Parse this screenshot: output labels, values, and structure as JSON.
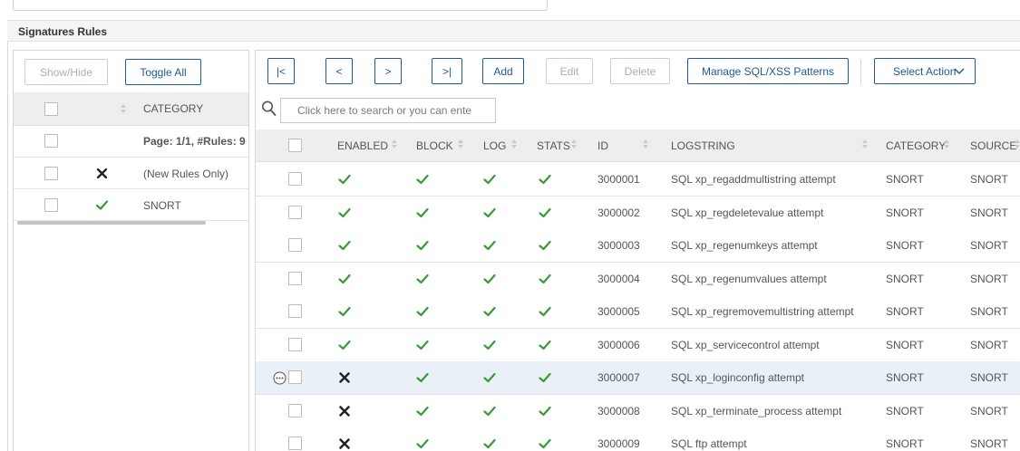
{
  "section": {
    "title": "Signatures Rules"
  },
  "left": {
    "show_hide": "Show/Hide",
    "toggle_all": "Toggle All",
    "header": {
      "category": "CATEGORY"
    },
    "rows": [
      {
        "label": "Page: 1/1, #Rules: 9",
        "status": "none"
      },
      {
        "label": "(New Rules Only)",
        "status": "cross"
      },
      {
        "label": "SNORT",
        "status": "check"
      }
    ]
  },
  "toolbar": {
    "first": "|<",
    "prev": "<",
    "next": ">",
    "last": ">|",
    "add": "Add",
    "edit": "Edit",
    "delete": "Delete",
    "manage": "Manage SQL/XSS Patterns",
    "select_action": "Select Action"
  },
  "search": {
    "placeholder": "Click here to search or you can ente"
  },
  "table": {
    "headers": {
      "enabled": "ENABLED",
      "block": "BLOCK",
      "log": "LOG",
      "stats": "STATS",
      "id": "ID",
      "logstring": "LOGSTRING",
      "category": "CATEGORY",
      "source": "SOURCE"
    },
    "rows": [
      {
        "enabled": true,
        "block": true,
        "log": true,
        "stats": true,
        "id": "3000001",
        "logstring": "SQL xp_regaddmultistring attempt",
        "category": "SNORT",
        "source": "SNORT",
        "selected": false
      },
      {
        "enabled": true,
        "block": true,
        "log": true,
        "stats": true,
        "id": "3000002",
        "logstring": "SQL xp_regdeletevalue attempt",
        "category": "SNORT",
        "source": "SNORT",
        "selected": false
      },
      {
        "enabled": true,
        "block": true,
        "log": true,
        "stats": true,
        "id": "3000003",
        "logstring": "SQL xp_regenumkeys attempt",
        "category": "SNORT",
        "source": "SNORT",
        "selected": false
      },
      {
        "enabled": true,
        "block": true,
        "log": true,
        "stats": true,
        "id": "3000004",
        "logstring": "SQL xp_regenumvalues attempt",
        "category": "SNORT",
        "source": "SNORT",
        "selected": false
      },
      {
        "enabled": true,
        "block": true,
        "log": true,
        "stats": true,
        "id": "3000005",
        "logstring": "SQL xp_regremovemultistring attempt",
        "category": "SNORT",
        "source": "SNORT",
        "selected": false
      },
      {
        "enabled": true,
        "block": true,
        "log": true,
        "stats": true,
        "id": "3000006",
        "logstring": "SQL xp_servicecontrol attempt",
        "category": "SNORT",
        "source": "SNORT",
        "selected": false
      },
      {
        "enabled": false,
        "block": true,
        "log": true,
        "stats": true,
        "id": "3000007",
        "logstring": "SQL xp_loginconfig attempt",
        "category": "SNORT",
        "source": "SNORT",
        "selected": true
      },
      {
        "enabled": false,
        "block": true,
        "log": true,
        "stats": true,
        "id": "3000008",
        "logstring": "SQL xp_terminate_process attempt",
        "category": "SNORT",
        "source": "SNORT",
        "selected": false
      },
      {
        "enabled": false,
        "block": true,
        "log": true,
        "stats": true,
        "id": "3000009",
        "logstring": "SQL ftp attempt",
        "category": "SNORT",
        "source": "SNORT",
        "selected": false
      }
    ]
  },
  "colors": {
    "accent": "#1f5a99",
    "check": "#3a9a3a",
    "cross": "#222222",
    "selected_row": "#e9f0f7"
  }
}
